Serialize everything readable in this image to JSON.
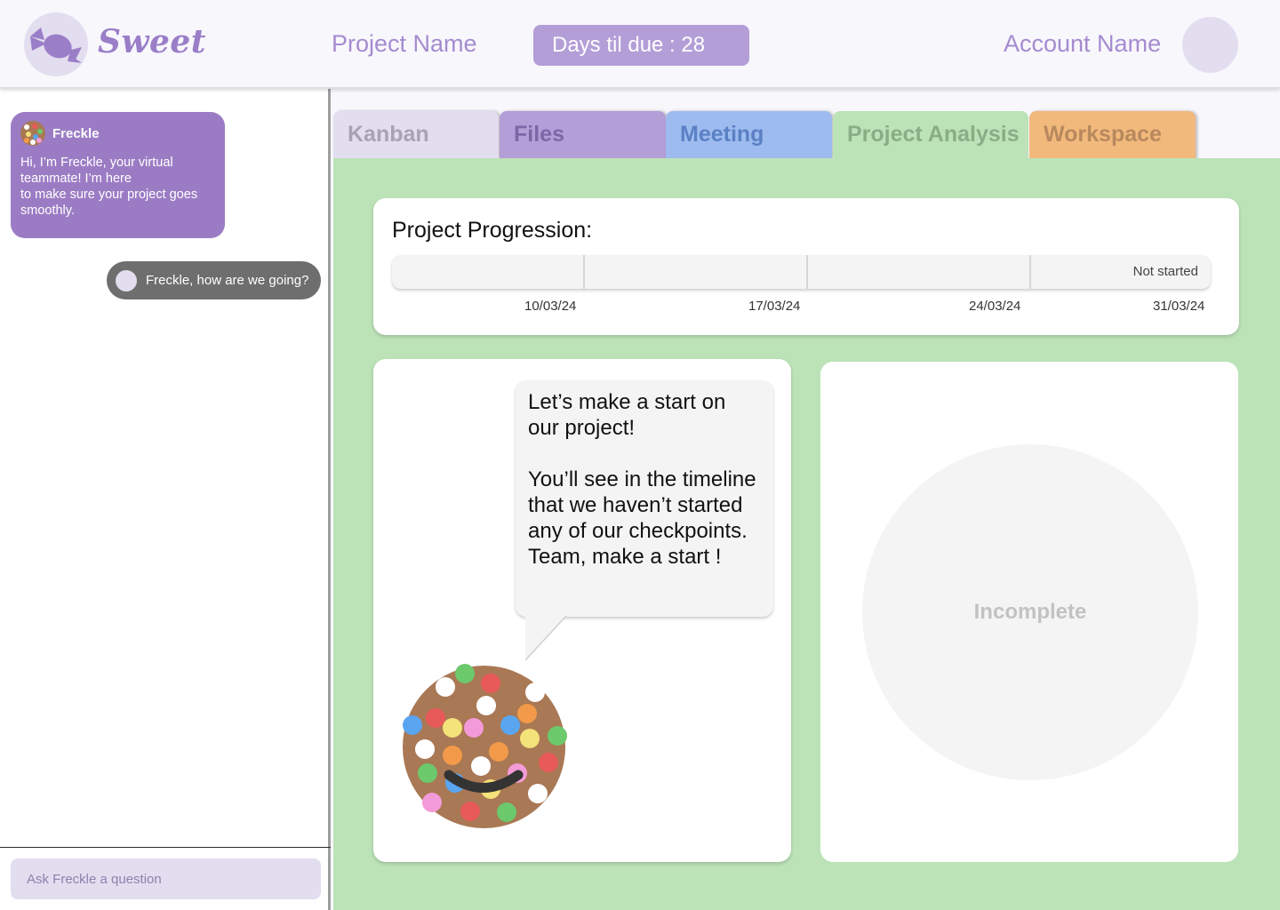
{
  "header": {
    "brand": "Sweet",
    "project_name": "Project Name",
    "days_due": "Days til due : 28",
    "account_name": "Account Name"
  },
  "sidebar": {
    "bot_name": "Freckle",
    "bot_message": "Hi, I’m Freckle, your virtual teammate! I’m here\nto make sure your project goes smoothly.",
    "user_message": "Freckle, how are we going?",
    "ask_placeholder": "Ask Freckle a question"
  },
  "tabs": [
    {
      "label": "Kanban",
      "color": "#e3ddf0"
    },
    {
      "label": "Files",
      "color": "#b49ed7"
    },
    {
      "label": "Meeting",
      "color": "#9dbbef"
    },
    {
      "label": "Project Analysis",
      "color": "#bce3b8",
      "active": true
    },
    {
      "label": "Workspace",
      "color": "#f2b97c"
    }
  ],
  "progression": {
    "title": "Project Progression:",
    "status": "Not started",
    "progress_percent": 0,
    "dates": [
      "10/03/24",
      "17/03/24",
      "24/03/24",
      "31/03/24"
    ]
  },
  "assistant": {
    "speech": "Let’s make a start on our project!\n\nYou’ll see in the timeline that we haven’t started any of our checkpoints. Team, make a start !"
  },
  "analysis": {
    "pie_label": "Incomplete"
  },
  "colors": {
    "accent": "#9b7cc4",
    "main_bg": "#bce3b8",
    "lavender": "#e3ddf0"
  },
  "icons": {
    "logo": "candy-icon",
    "cookie": "freckle-cookie-icon"
  }
}
